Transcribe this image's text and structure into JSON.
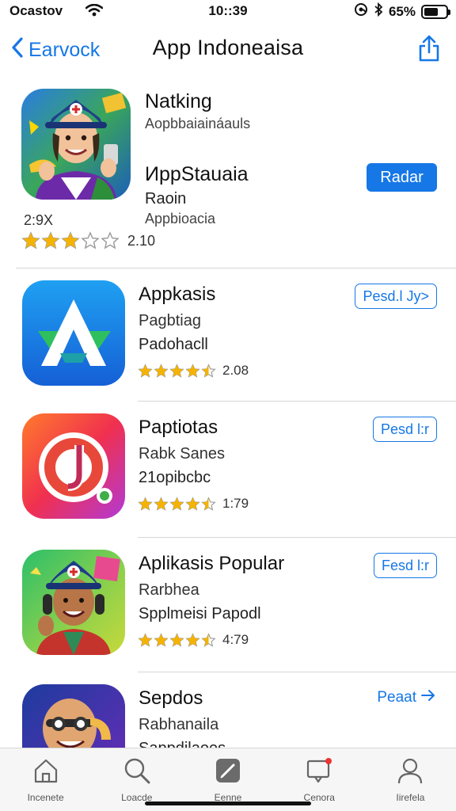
{
  "status_bar": {
    "carrier": "Ocastov",
    "time": "10::39",
    "battery_percent": "65%",
    "battery_level": 0.65
  },
  "nav": {
    "back_label": "Earvock",
    "title": "App Indoneaisa"
  },
  "featured": {
    "name": "Natking",
    "subtitle": "Aopbbaiaináauls",
    "title2": "ИppStauaia",
    "subtitle2": "Raoin",
    "subtitle3": "Appbioacia",
    "size": "2:9X",
    "rating_count": "2.10",
    "stars": 3,
    "button_label": "Radar",
    "icon": "avatar-helmet-icon"
  },
  "apps": [
    {
      "name": "Appkasis",
      "line1": "Pagbtiag",
      "line2": "Padohacll",
      "rating_count": "2.08",
      "stars": 4.5,
      "button_label": "Pesd.l Jy>",
      "button_style": "outline",
      "icon": "triangle-a-logo-icon"
    },
    {
      "name": "Paptiotas",
      "line1": "Rabk Sanes",
      "line2": "21opibcbc",
      "rating_count": "1:79",
      "stars": 4.5,
      "button_label": "Pesd l:r",
      "button_style": "outline",
      "icon": "ring-j-logo-icon"
    },
    {
      "name": "Aplikasis Popular",
      "line1": "Rarbhea",
      "line2": "Spplmeisi Papodl",
      "rating_count": "4:79",
      "stars": 4.5,
      "button_label": "Fesd l:r",
      "button_style": "outline",
      "icon": "avatar-headphones-icon"
    },
    {
      "name": "Sepdos",
      "line1": "Rabhanaila",
      "line2": "Sappdilaoes",
      "button_label": "Peaat",
      "button_style": "text",
      "icon": "avatar-bald-icon"
    }
  ],
  "tabs": [
    {
      "label": "Incenete",
      "icon": "house-icon"
    },
    {
      "label": "Loacde",
      "icon": "search-icon"
    },
    {
      "label": "Eenne",
      "icon": "pen-icon"
    },
    {
      "label": "Cenora",
      "icon": "message-icon"
    },
    {
      "label": "Iirefela",
      "icon": "person-icon"
    }
  ],
  "colors": {
    "accent": "#1677e6",
    "star": "#f5b301"
  }
}
